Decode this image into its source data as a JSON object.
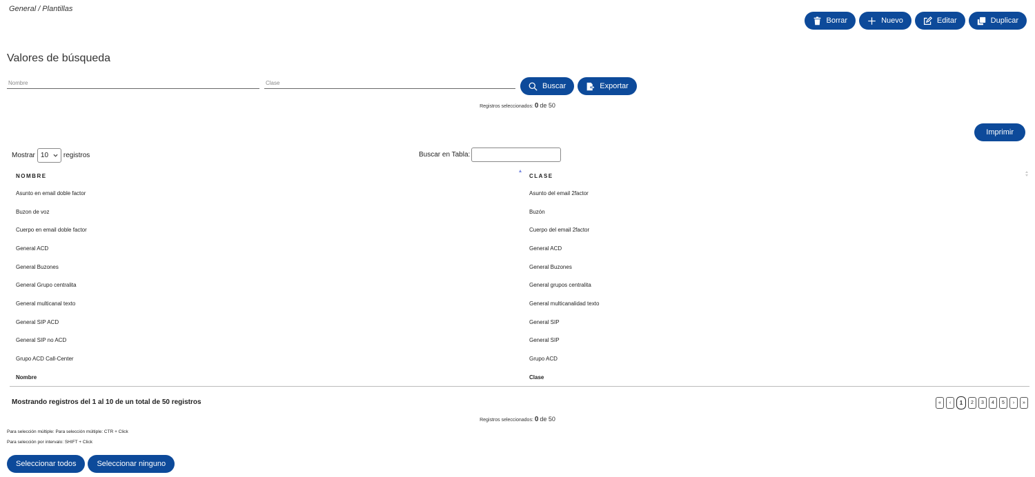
{
  "breadcrumb": "General / Plantillas",
  "colors": {
    "primary": "#0d4a9a",
    "sort_active": "#7a8ae0"
  },
  "toolbar": {
    "delete": {
      "label": "Borrar",
      "icon": "trash-icon"
    },
    "new": {
      "label": "Nuevo",
      "icon": "plus-icon"
    },
    "edit": {
      "label": "Editar",
      "icon": "edit-icon"
    },
    "duplicate": {
      "label": "Duplicar",
      "icon": "duplicate-icon"
    }
  },
  "search": {
    "title": "Valores de búsqueda",
    "nombre_placeholder": "Nombre",
    "nombre_value": "",
    "clase_placeholder": "Clase",
    "clase_value": "",
    "search_label": "Buscar",
    "export_label": "Exportar"
  },
  "selection": {
    "label": "Registros seleccionados:",
    "selected": "0",
    "of": "de 50"
  },
  "print_label": "Imprimir",
  "table_controls": {
    "show_prefix": "Mostrar",
    "page_length": "10",
    "show_suffix": "registros",
    "filter_label": "Buscar en Tabla:",
    "filter_value": ""
  },
  "table": {
    "headers": [
      "NOMBRE",
      "CLASE"
    ],
    "rows": [
      [
        "Asunto en email doble factor",
        "Asunto del email 2factor"
      ],
      [
        "Buzon de voz",
        "Buzón"
      ],
      [
        "Cuerpo en email doble factor",
        "Cuerpo del email 2factor"
      ],
      [
        "General ACD",
        "General ACD"
      ],
      [
        "General Buzones",
        "General Buzones"
      ],
      [
        "General Grupo centralita",
        "General grupos centralita"
      ],
      [
        "General multicanal texto",
        "General multicanalidad texto"
      ],
      [
        "General SIP ACD",
        "General SIP"
      ],
      [
        "General SIP no ACD",
        "General SIP"
      ],
      [
        "Grupo ACD Call-Center",
        "Grupo ACD"
      ]
    ],
    "footers": [
      "Nombre",
      "Clase"
    ]
  },
  "info": "Mostrando registros del 1 al 10 de un total de 50 registros",
  "pagination": {
    "first": "«",
    "prev": "‹",
    "pages": [
      "1",
      "2",
      "3",
      "4",
      "5"
    ],
    "current": "1",
    "next": "›",
    "last": "»"
  },
  "hints": {
    "multi": "Para selección múltiple: Para selección múltiple: CTR + Click",
    "range": "Para selección por intervalo: SHIFT + Click"
  },
  "bottom_actions": {
    "select_all": "Seleccionar todos",
    "select_none": "Seleccionar ninguno"
  }
}
